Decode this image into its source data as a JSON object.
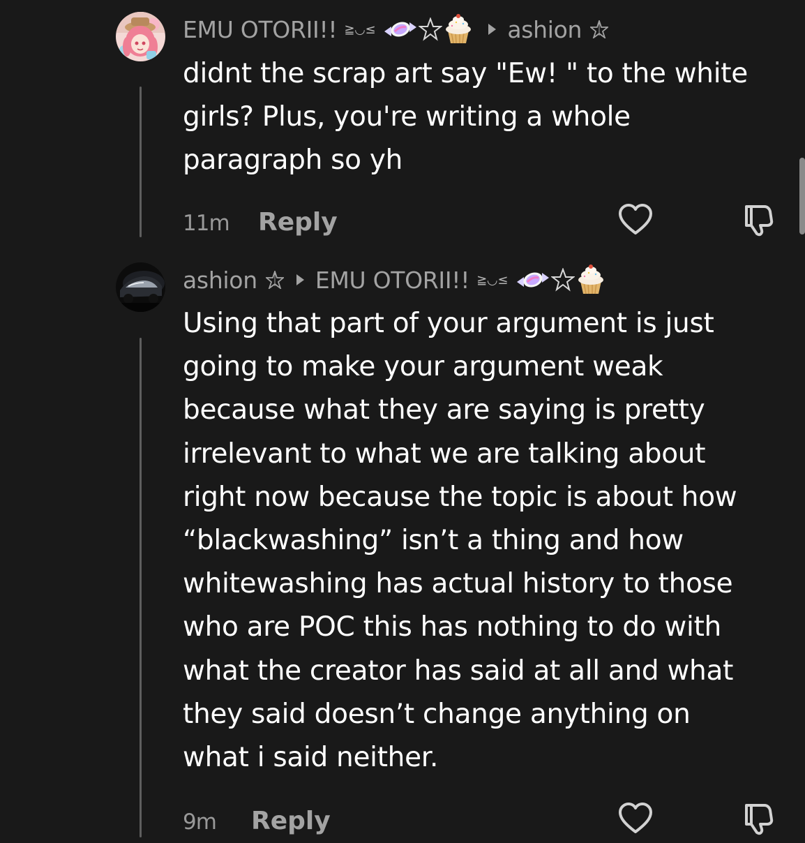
{
  "comments": [
    {
      "author": "EMU OTORII!!",
      "author_kaomoji": "≧◡≤",
      "reply_to": "ashion",
      "text_lines": [
        "didnt the scrap art say \"Ew! \" to the white",
        "girls? Plus, you're writing a whole",
        "paragraph so yh"
      ],
      "time": "11m",
      "reply_label": "Reply",
      "avatar_icon": "anime-girl-avatar"
    },
    {
      "author": "ashion",
      "reply_to": "EMU OTORII!!",
      "reply_to_kaomoji": "≧◡≤",
      "text_lines": [
        "Using that part of your argument is just",
        "going to make your argument weak",
        "because what they are saying is pretty",
        "irrelevant to what we are talking about",
        "right now because the topic is about how",
        "“blackwashing” isn’t a thing and how",
        "whitewashing has actual history to those",
        "who are POC this has nothing to do with",
        "what the creator has said at all and what",
        "they said doesn’t change anything on",
        "what i said neither."
      ],
      "time": "9m",
      "reply_label": "Reply",
      "avatar_icon": "dark-car-avatar"
    }
  ],
  "colors": {
    "background": "#191919",
    "text": "#ffffff",
    "muted": "#a3a3a3",
    "thread_line": "#5e5e5e"
  }
}
